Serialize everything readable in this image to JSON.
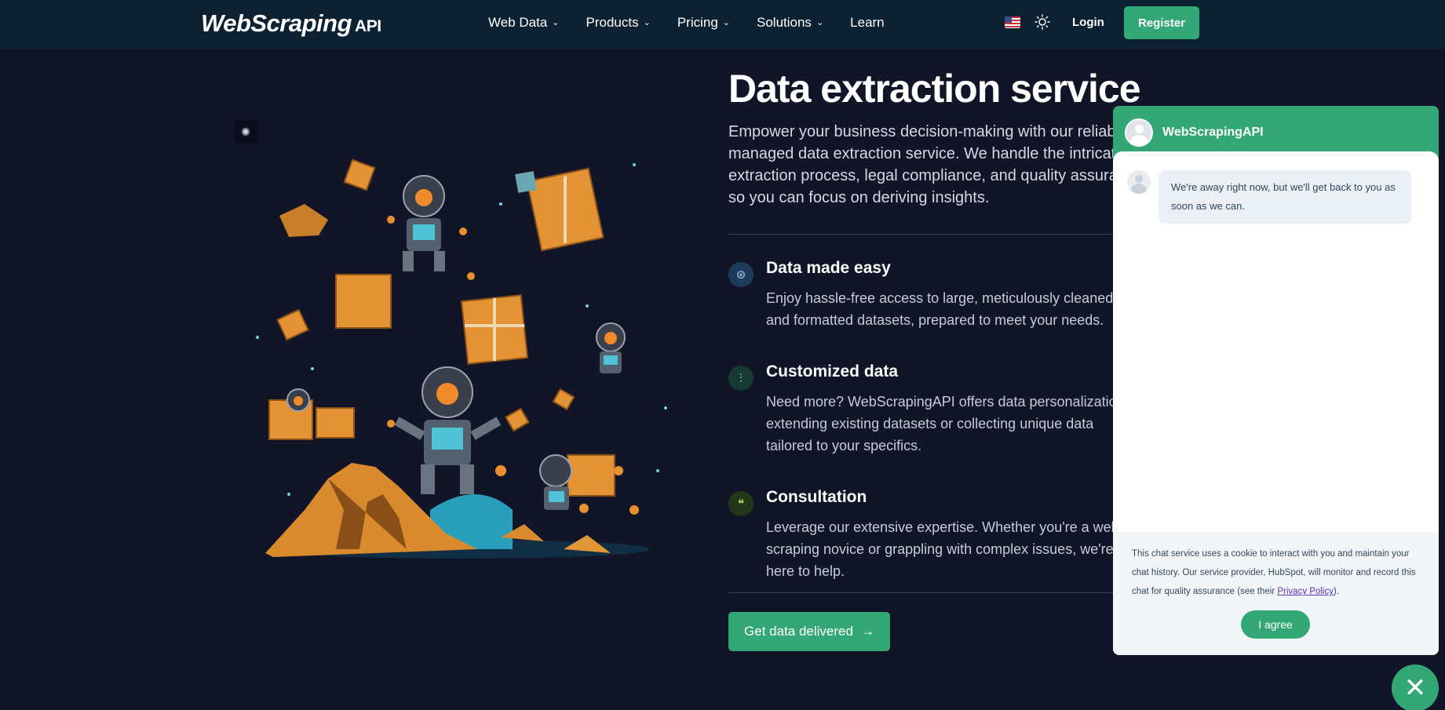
{
  "nav": {
    "logo": "WebScraping",
    "logo_suffix": "API",
    "menu": [
      {
        "label": "Web Data",
        "has_dropdown": true
      },
      {
        "label": "Products",
        "has_dropdown": true
      },
      {
        "label": "Pricing",
        "has_dropdown": true
      },
      {
        "label": "Solutions",
        "has_dropdown": true
      },
      {
        "label": "Learn",
        "has_dropdown": false
      }
    ],
    "login": "Login",
    "register": "Register",
    "icons": [
      "us-flag-icon",
      "sun-icon"
    ]
  },
  "main": {
    "title": "Data extraction service",
    "lead": "Empower your business decision-making with our reliable managed data extraction service. We handle the intricate extraction process, legal compliance, and quality assurance so you can focus on deriving insights.",
    "features": [
      {
        "title": "Data made easy",
        "text": "Enjoy hassle-free access to large, meticulously cleaned and formatted datasets, prepared to meet your needs.",
        "icon": "dataset-icon"
      },
      {
        "title": "Customized data",
        "text": "Need more? WebScrapingAPI offers data personalization, extending existing datasets or collecting unique data tailored to your specifics.",
        "icon": "sliders-icon"
      },
      {
        "title": "Consultation",
        "text": "Leverage our extensive expertise. Whether you're a web scraping novice or grappling with complex issues, we're here to help.",
        "icon": "chat-bubbles-icon"
      }
    ],
    "cta": "Get data delivered",
    "cta_icon": "→"
  },
  "chat": {
    "name": "WebScrapingAPI",
    "message": "We're away right now, but we'll get back to you as soon as we can.",
    "consent_text": "This chat service uses a cookie to interact with you and maintain your chat history. Our service provider, HubSpot, will monitor and record this chat for quality assurance (see their ",
    "consent_link": "Privacy Policy",
    "consent_end": ").",
    "agree": "I agree",
    "close_icon": "✕"
  },
  "colors": {
    "background": "#121527",
    "nav": "#0c2233",
    "accent": "#34a776",
    "orange": "#e8902f"
  }
}
